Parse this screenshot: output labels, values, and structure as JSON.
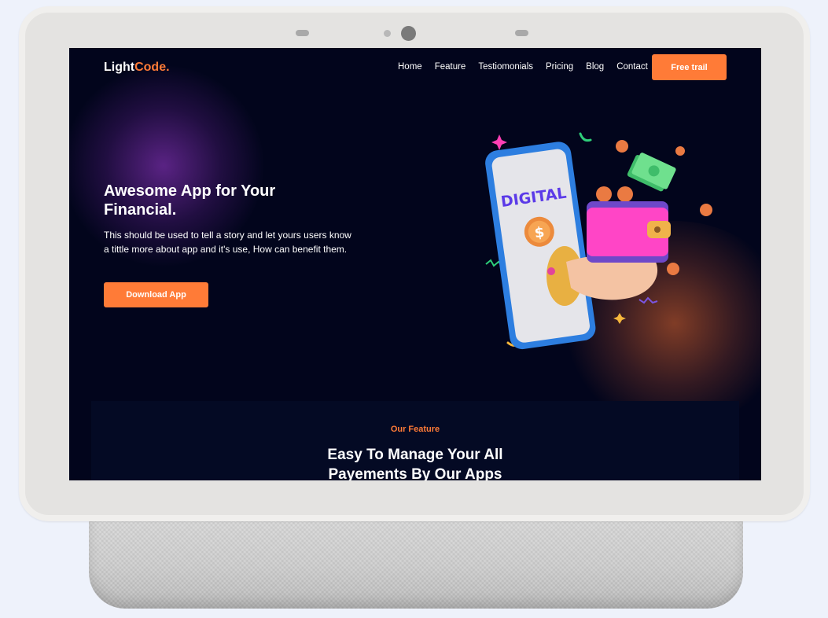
{
  "brand": {
    "name_main": "Light",
    "name_accent": "Code."
  },
  "nav": {
    "items": [
      "Home",
      "Feature",
      "Testiomonials",
      "Pricing",
      "Blog",
      "Contact"
    ],
    "cta_label": "Free trail"
  },
  "hero": {
    "title": "Awesome App for Your Financial.",
    "text": "This should be used to tell a story and let yours users know a tittle more about app and it's use, How can benefit them.",
    "button_label": "Download App",
    "illustration": {
      "phone_label": "DIGITAL",
      "coin_symbol": "$"
    }
  },
  "feature": {
    "eyebrow": "Our Feature",
    "title": "Easy To Manage Your All Payements By Our Apps"
  },
  "colors": {
    "accent": "#ff7b37",
    "screen_bg": "#02051c",
    "device_frame": "#e4e3e1",
    "page_bg": "#eef2fb"
  }
}
